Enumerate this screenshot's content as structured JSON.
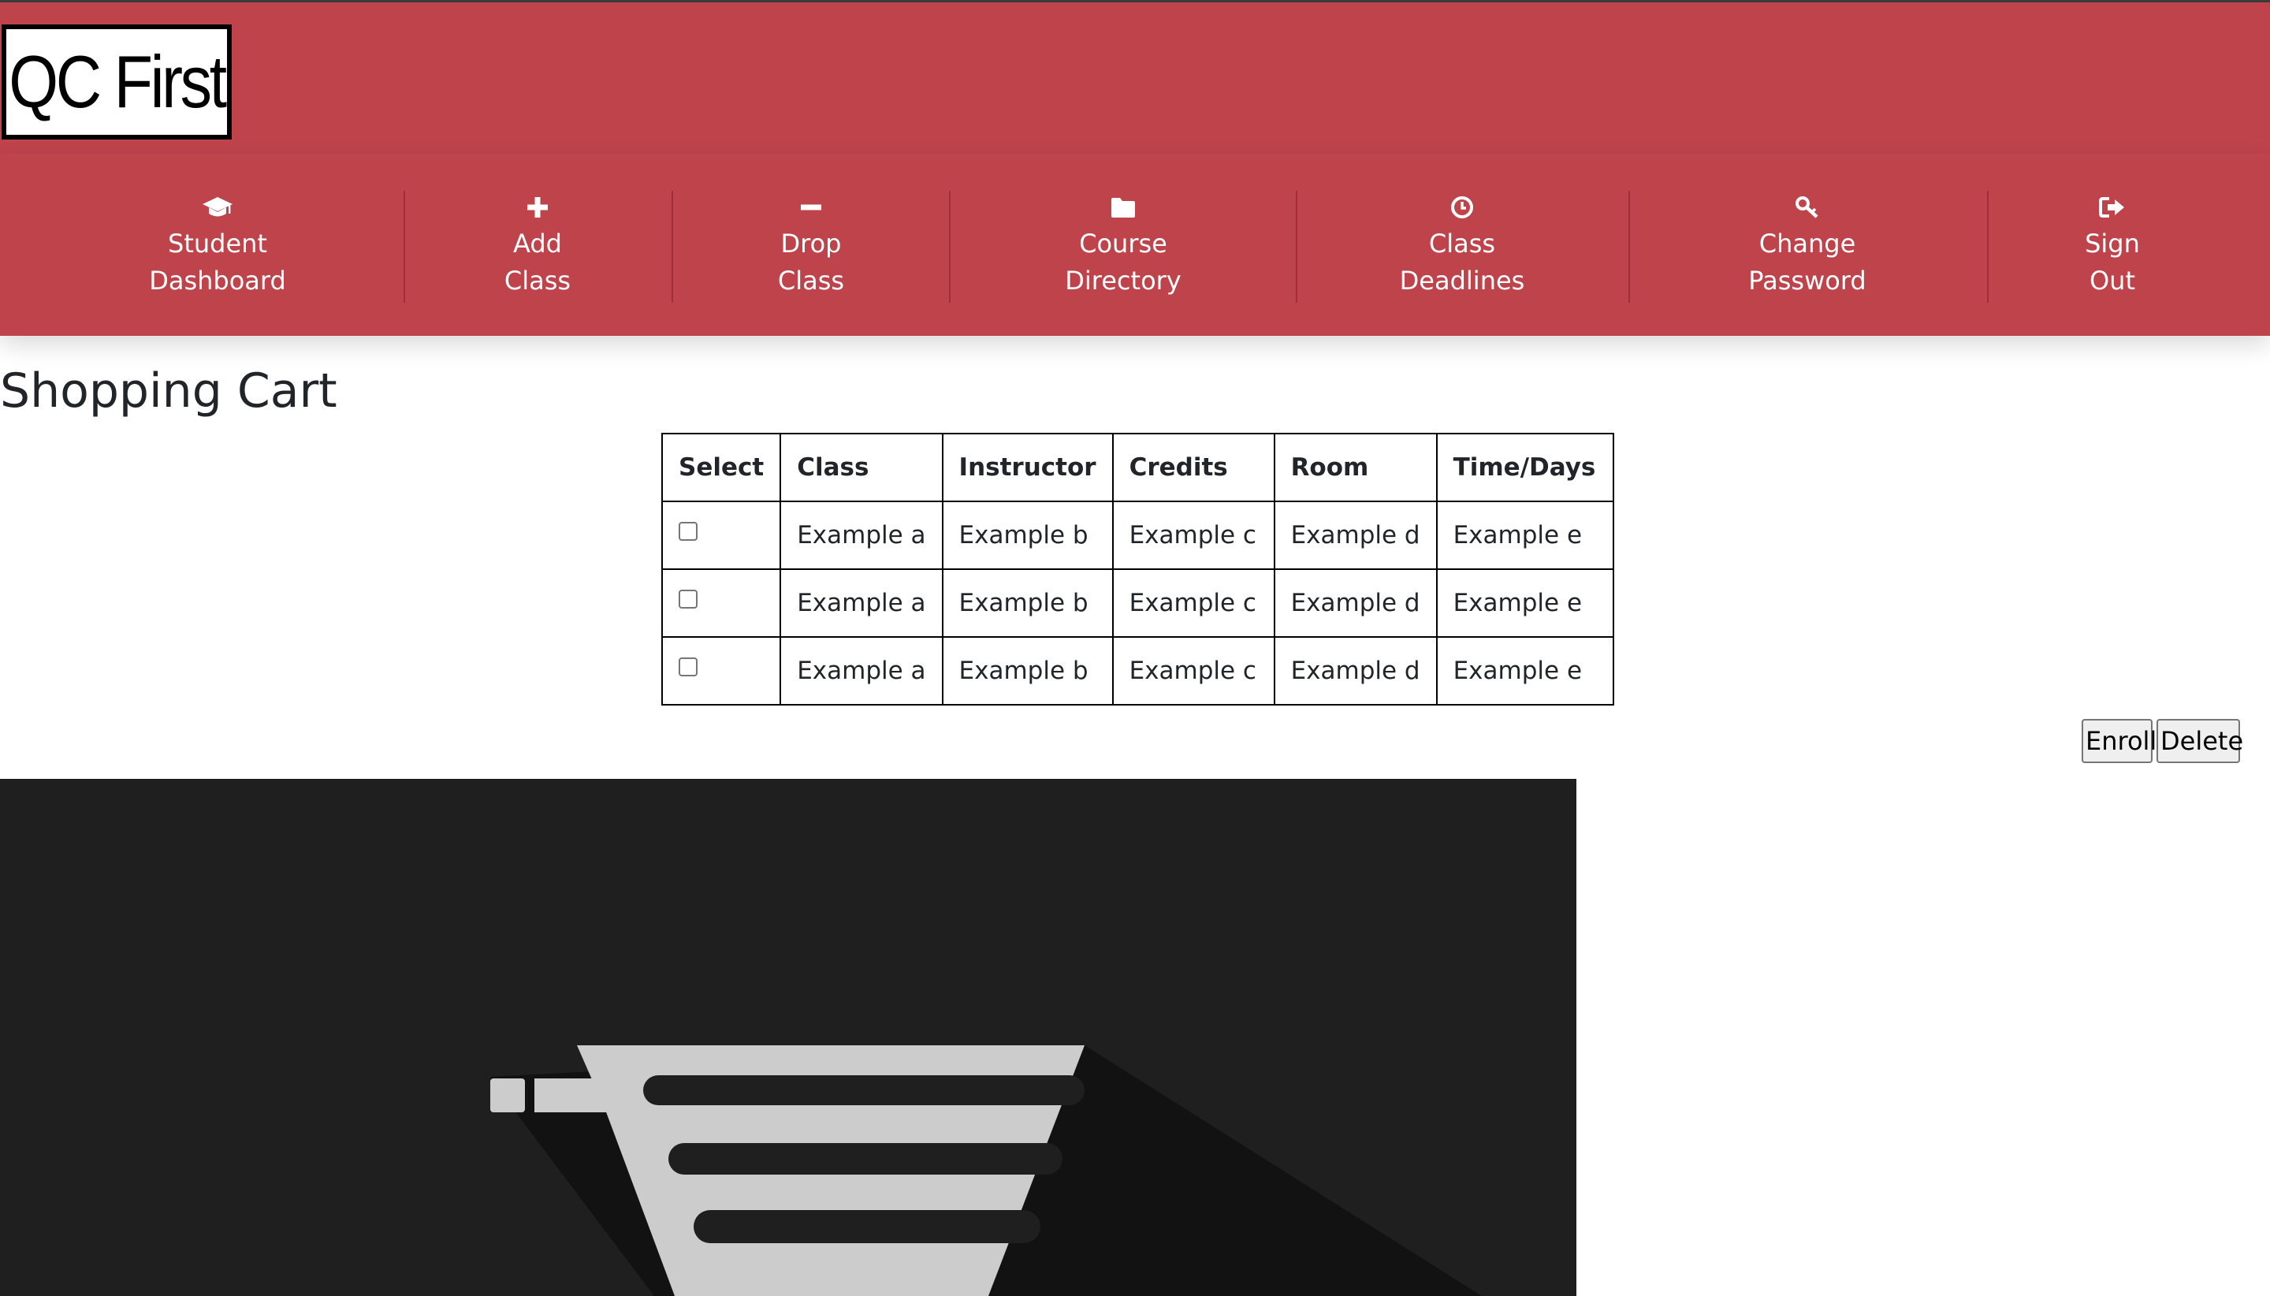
{
  "brand": {
    "logo_text": "QC First",
    "header_color": "#be434b"
  },
  "nav": {
    "items": [
      {
        "line1": "Student",
        "line2": "Dashboard",
        "icon": "graduation-cap-icon"
      },
      {
        "line1": "Add",
        "line2": "Class",
        "icon": "plus-icon"
      },
      {
        "line1": "Drop",
        "line2": "Class",
        "icon": "minus-icon"
      },
      {
        "line1": "Course",
        "line2": "Directory",
        "icon": "folder-icon"
      },
      {
        "line1": "Class",
        "line2": "Deadlines",
        "icon": "clock-icon"
      },
      {
        "line1": "Change",
        "line2": "Password",
        "icon": "key-icon"
      },
      {
        "line1": "Sign",
        "line2": "Out",
        "icon": "sign-out-icon"
      }
    ]
  },
  "page": {
    "title": "Shopping Cart"
  },
  "cart_table": {
    "headers": [
      "Select",
      "Class",
      "Instructor",
      "Credits",
      "Room",
      "Time/Days"
    ],
    "rows": [
      {
        "selected": false,
        "class": "Example a",
        "instructor": "Example b",
        "credits": "Example c",
        "room": "Example d",
        "time_days": "Example e"
      },
      {
        "selected": false,
        "class": "Example a",
        "instructor": "Example b",
        "credits": "Example c",
        "room": "Example d",
        "time_days": "Example e"
      },
      {
        "selected": false,
        "class": "Example a",
        "instructor": "Example b",
        "credits": "Example c",
        "room": "Example d",
        "time_days": "Example e"
      }
    ]
  },
  "actions": {
    "enroll_label": "Enroll",
    "delete_label": "Delete"
  },
  "banner": {
    "icon": "shopping-cart-icon",
    "background_color": "#1f1f1f",
    "icon_color": "#cccccc"
  }
}
